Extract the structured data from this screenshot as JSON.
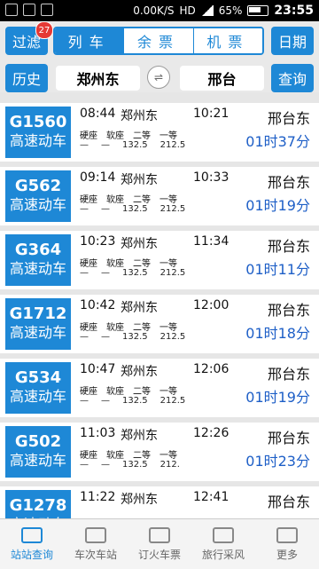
{
  "status_bar": {
    "network": "0.00K/S",
    "hd": "HD",
    "battery_percent": "65%",
    "time": "23:55"
  },
  "header": {
    "filter_label": "过滤",
    "filter_badge": "27",
    "tabs": [
      {
        "label": "列车",
        "active": true
      },
      {
        "label": "余票",
        "active": false
      },
      {
        "label": "机票",
        "active": false
      }
    ],
    "date_label": "日期",
    "history_label": "历史",
    "from_station": "郑州东",
    "to_station": "邢台",
    "swap_symbol": "⇌",
    "query_label": "查询"
  },
  "seat_labels": [
    "硬座",
    "软座",
    "二等",
    "一等"
  ],
  "trains": [
    {
      "code": "G1560",
      "type": "高速动车",
      "dep_time": "08:44",
      "dep_station": "郑州东",
      "arr_time": "10:21",
      "arr_station": "邢台东",
      "duration": "01时37分",
      "prices": [
        "—",
        "—",
        "132.5",
        "212.5"
      ]
    },
    {
      "code": "G562",
      "type": "高速动车",
      "dep_time": "09:14",
      "dep_station": "郑州东",
      "arr_time": "10:33",
      "arr_station": "邢台东",
      "duration": "01时19分",
      "prices": [
        "—",
        "—",
        "132.5",
        "212.5"
      ]
    },
    {
      "code": "G364",
      "type": "高速动车",
      "dep_time": "10:23",
      "dep_station": "郑州东",
      "arr_time": "11:34",
      "arr_station": "邢台东",
      "duration": "01时11分",
      "prices": [
        "—",
        "—",
        "132.5",
        "212.5"
      ]
    },
    {
      "code": "G1712",
      "type": "高速动车",
      "dep_time": "10:42",
      "dep_station": "郑州东",
      "arr_time": "12:00",
      "arr_station": "邢台东",
      "duration": "01时18分",
      "prices": [
        "—",
        "—",
        "132.5",
        "212.5"
      ]
    },
    {
      "code": "G534",
      "type": "高速动车",
      "dep_time": "10:47",
      "dep_station": "郑州东",
      "arr_time": "12:06",
      "arr_station": "邢台东",
      "duration": "01时19分",
      "prices": [
        "—",
        "—",
        "132.5",
        "212.5"
      ]
    },
    {
      "code": "G502",
      "type": "高速动车",
      "dep_time": "11:03",
      "dep_station": "郑州东",
      "arr_time": "12:26",
      "arr_station": "邢台东",
      "duration": "01时23分",
      "prices": [
        "—",
        "—",
        "132.5",
        "212."
      ]
    },
    {
      "code": "G1278",
      "type": "高速动车",
      "dep_time": "11:22",
      "dep_station": "郑州东",
      "arr_time": "12:41",
      "arr_station": "邢台东",
      "duration": "",
      "prices": [
        "",
        "",
        "",
        ""
      ]
    }
  ],
  "tabbar": [
    {
      "label": "站站查询",
      "icon": "train-icon",
      "active": true
    },
    {
      "label": "车次车站",
      "icon": "briefcase-icon",
      "active": false
    },
    {
      "label": "订火车票",
      "icon": "ticket-icon",
      "active": false
    },
    {
      "label": "旅行采风",
      "icon": "chat-icon",
      "active": false
    },
    {
      "label": "更多",
      "icon": "grid-icon",
      "active": false
    }
  ]
}
